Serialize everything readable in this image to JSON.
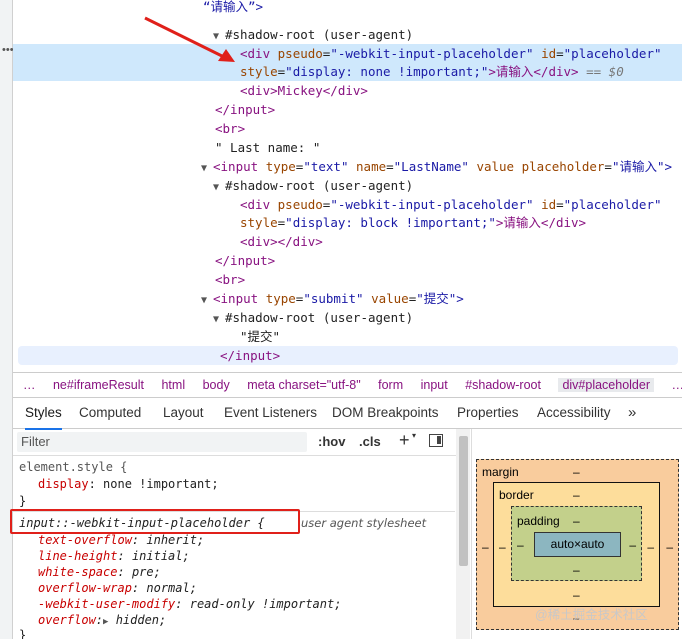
{
  "dom_lines": [
    {
      "text": "“请输入”>"
    },
    {
      "text": "#shadow-root (user-agent)"
    },
    {
      "tag_open": "<div",
      "a1": "pseudo",
      "v1": "\"-webkit-input-placeholder\"",
      "a2": "id",
      "v2": "\"placeholder\""
    },
    {
      "a3": "style",
      "v3": "\"display: none !important;\"",
      "text": ">请输入</div>",
      "eq": "== $0"
    },
    {
      "text": "<div>Mickey</div>"
    },
    {
      "text": "</input>"
    },
    {
      "text": "<br>"
    },
    {
      "text": "\" Last name: \""
    },
    {
      "tag_open": "<input",
      "a1": "type",
      "v1": "\"text\"",
      "a2": "name",
      "v2": "\"LastName\"",
      "a3": "value",
      "a4": "placeholder",
      "v4": "\"请输入\">"
    },
    {
      "text": "#shadow-root (user-agent)"
    },
    {
      "tag_open": "<div",
      "a1": "pseudo",
      "v1": "\"-webkit-input-placeholder\"",
      "a2": "id",
      "v2": "\"placeholder\""
    },
    {
      "a3": "style",
      "v3": "\"display: block !important;\"",
      "text": ">请输入</div>"
    },
    {
      "text": "<div></div>"
    },
    {
      "text": "</input>"
    },
    {
      "text": "<br>"
    },
    {
      "tag_open": "<input",
      "a1": "type",
      "v1": "\"submit\"",
      "a2": "value",
      "v2": "\"提交\">"
    },
    {
      "text": "#shadow-root (user-agent)"
    },
    {
      "text": "\"提交\""
    },
    {
      "text": "</input>"
    }
  ],
  "breadcrumbs": [
    "…",
    "ne#iframeResult",
    "html",
    "body",
    "meta charset=\"utf-8\"",
    "form",
    "input",
    "#shadow-root",
    "div#placeholder",
    "…"
  ],
  "tabs": [
    "Styles",
    "Computed",
    "Layout",
    "Event Listeners",
    "DOM Breakpoints",
    "Properties",
    "Accessibility",
    "»"
  ],
  "filter": {
    "placeholder": "Filter",
    "hov": ":hov",
    "cls": ".cls",
    "add": "+"
  },
  "element_style": {
    "selector": "element.style {",
    "prop": "display",
    "value": "none !important;",
    "close": "}"
  },
  "ua_rule": {
    "selector": "input::-webkit-input-placeholder {",
    "origin": "user agent stylesheet",
    "props": [
      {
        "name": "text-overflow",
        "value": "inherit;"
      },
      {
        "name": "line-height",
        "value": "initial;"
      },
      {
        "name": "white-space",
        "value": "pre;"
      },
      {
        "name": "overflow-wrap",
        "value": "normal;"
      },
      {
        "name": "-webkit-user-modify",
        "value": "read-only !important;"
      },
      {
        "name": "overflow",
        "value": "hidden;"
      }
    ],
    "close": "}"
  },
  "box_model": {
    "margin": "margin",
    "border": "border",
    "padding": "padding",
    "content": "auto×auto",
    "dash": "–"
  },
  "watermark": "@稀土掘金技术社区",
  "colors": {
    "accent": "#1a73e8",
    "highlight": "#e0201a",
    "margin": "#f9cc9d",
    "border": "#fddd9b",
    "padding": "#c3d08b",
    "content": "#8cb6c0"
  }
}
